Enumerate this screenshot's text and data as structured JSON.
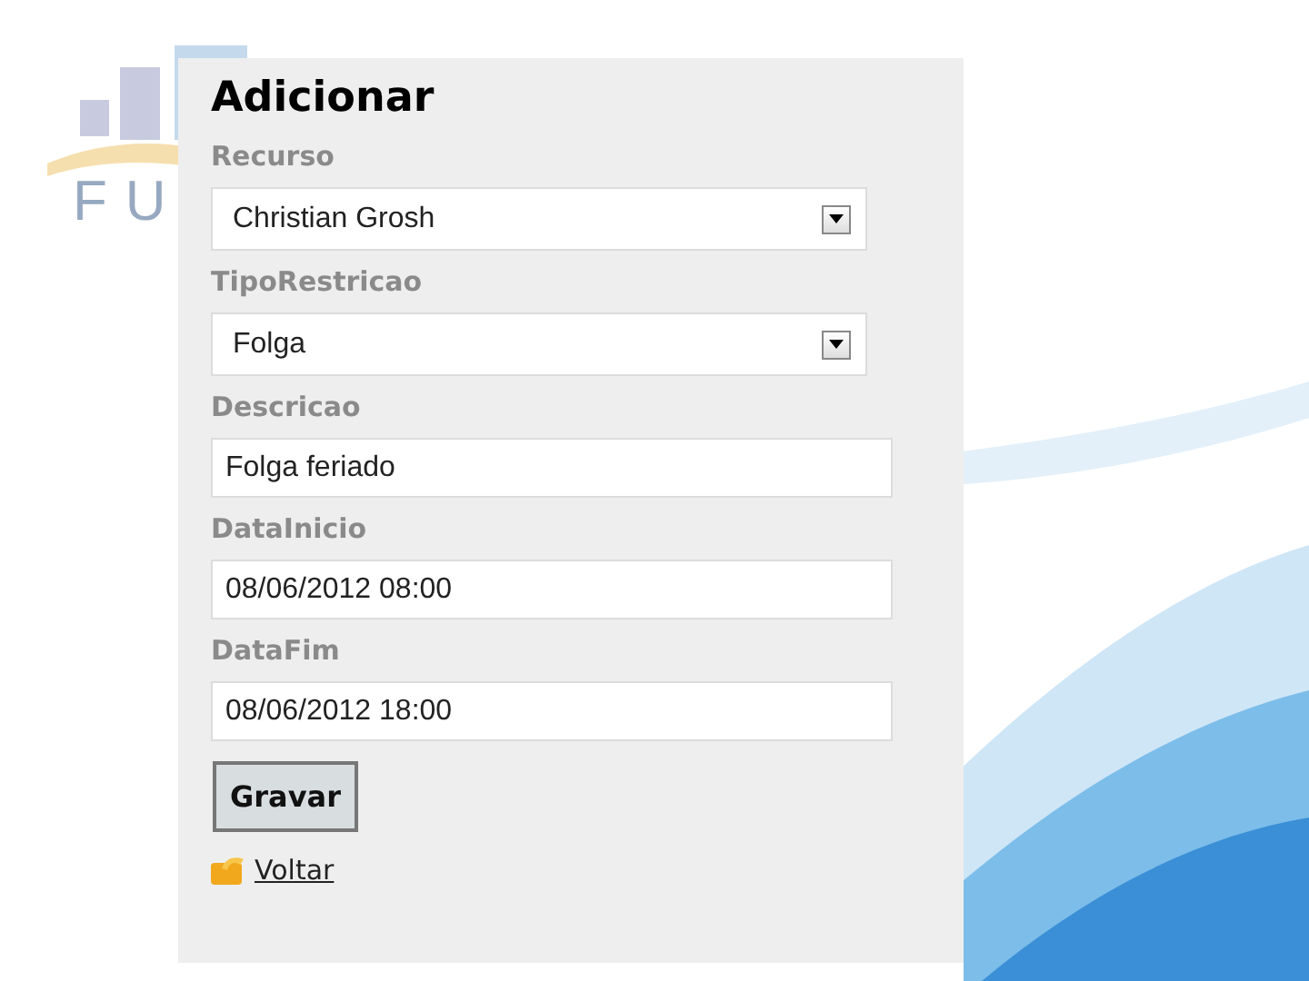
{
  "slide": {
    "logo_text": "FU"
  },
  "form": {
    "title": "Adicionar",
    "fields": [
      {
        "label": "Recurso",
        "kind": "select",
        "value": "Christian Grosh"
      },
      {
        "label": "TipoRestricao",
        "kind": "select",
        "value": "Folga"
      },
      {
        "label": "Descricao",
        "kind": "text",
        "value": "Folga feriado"
      },
      {
        "label": "DataInicio",
        "kind": "text",
        "value": "08/06/2012 08:00"
      },
      {
        "label": "DataFim",
        "kind": "text",
        "value": "08/06/2012 18:00"
      }
    ],
    "submit": "Gravar",
    "back_link": "Voltar"
  }
}
